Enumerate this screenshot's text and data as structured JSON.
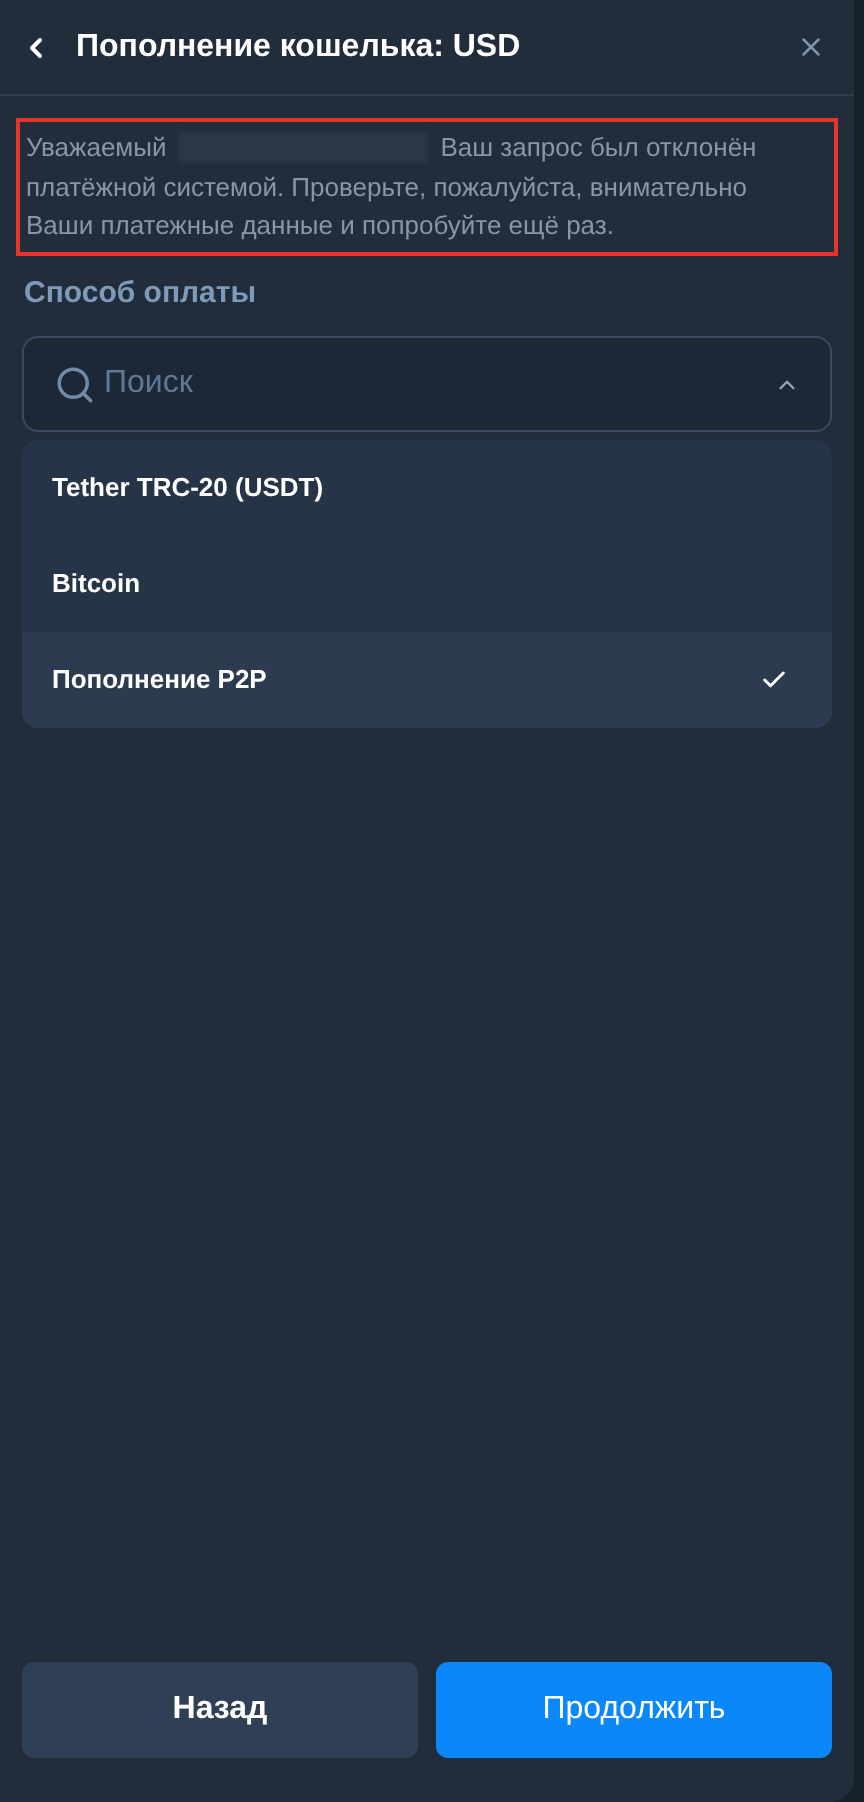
{
  "header": {
    "title": "Пополнение кошелька: USD"
  },
  "alert": {
    "greeting": "Уважаемый",
    "body_first_line": "Ваш запрос был отклонён",
    "body_rest": "платёжной системой. Проверьте, пожалуйста, внимательно Ваши платежные данные и попробуйте ещё раз."
  },
  "payment_method": {
    "label": "Способ оплаты",
    "search": {
      "placeholder": "Поиск"
    },
    "expanded": true,
    "options": [
      {
        "label": "Tether TRC-20 (USDT)",
        "selected": false
      },
      {
        "label": "Bitcoin",
        "selected": false
      },
      {
        "label": "Пополнение P2P",
        "selected": true
      }
    ]
  },
  "buttons": [
    {
      "label": "Назад",
      "kind": "secondary"
    },
    {
      "label": "Продолжить",
      "kind": "primary"
    }
  ]
}
